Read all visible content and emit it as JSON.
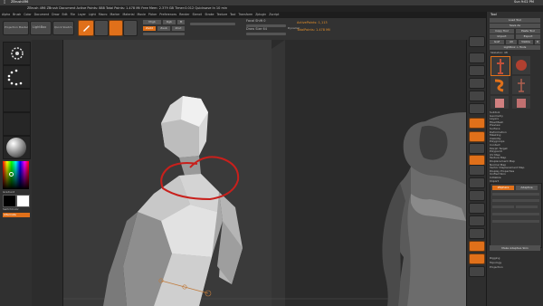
{
  "app": {
    "mac_menu_title": "ZBrush4R6",
    "title_bar": "ZBrush 4R6  ZBrush Document  Active Points: 888  Total Points: 1.478 Mil  Free Mem: 2.379 GB  Timer:0.012  Quicksave In 10 min",
    "clock": "Sun 9:02 PM"
  },
  "menu": {
    "items": [
      "Alpha",
      "Brush",
      "Color",
      "Document",
      "Draw",
      "Edit",
      "File",
      "Layer",
      "Light",
      "Macro",
      "Marker",
      "Material",
      "Movie",
      "Picker",
      "Preferences",
      "Render",
      "Stencil",
      "Stroke",
      "Texture",
      "Tool",
      "Transform",
      "Zplugin",
      "Zscript"
    ]
  },
  "top_shelf": {
    "projection_master": "Projection Master",
    "lightbox": "LightBox",
    "quick_sketch": "Quick Sketch",
    "focal_shift_label": "Focal Shift 0",
    "draw_size_label": "Draw Size 64",
    "dynamic_label": "Dynamic",
    "active_points": "ActivePoints: 1,113",
    "total_points": "TotalPoints: 1.478 Mil",
    "mrgb": "Mrgb",
    "rgb": "Rgb",
    "m": "M",
    "zadd": "Zadd",
    "zsub": "Zsub",
    "zcut": "Zcut"
  },
  "left_panel": {
    "gradient_label": "Gradient",
    "switch_color_label": "SwitchColor",
    "alternate_label": "Alternate"
  },
  "right_panel": {
    "tool_header": "Tool",
    "load_tool": "Load Tool",
    "save_as": "Save As",
    "copy_tool": "Copy Tool",
    "paste_tool": "Paste Tool",
    "import": "Import",
    "export": "Export",
    "goz": "GoZ",
    "all": "All",
    "visible": "Visible",
    "r": "R",
    "lightbox_tools": "Lightbox > Tools",
    "current_tool": "Skeleton: 48",
    "menu_items": [
      "Subtool",
      "Geometry",
      "Layers",
      "FiberMesh",
      "Preview",
      "Surface",
      "Deformation",
      "Masking",
      "Visibility",
      "Polygroups",
      "Contact",
      "Morph Target",
      "Polypaint",
      "UV Map",
      "Texture Map",
      "Displacement Map",
      "Normal Map",
      "Vector Displacement Map",
      "Display Properties",
      "Unified Skin",
      "Initialize",
      "Import",
      "Export"
    ],
    "zsphere_tab": "ZSphere",
    "adaptive_tab": "Adaptive",
    "make_adaptive_skin": "Make Adaptive Skin",
    "lower_items": [
      "Rigging",
      "Topology",
      "Projection"
    ]
  },
  "colors": {
    "accent_orange": "#e0701a",
    "annotation_red": "#c8201c",
    "ui_dark": "#2f2f2f"
  }
}
